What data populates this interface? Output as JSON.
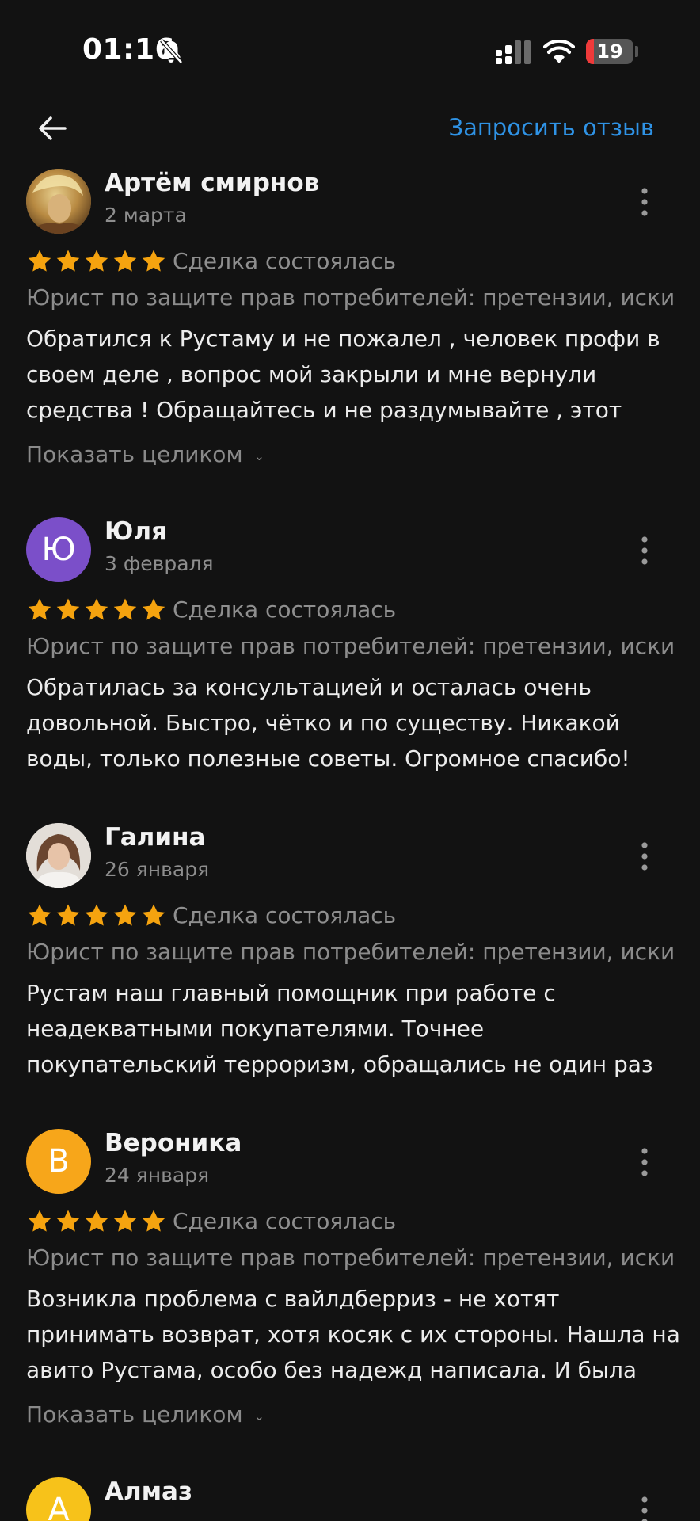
{
  "status_bar": {
    "time": "01:16",
    "battery": "19"
  },
  "header": {
    "request_review": "Запросить отзыв"
  },
  "reviews": [
    {
      "name": "Артём смирнов",
      "date": "2 марта",
      "rating": 5,
      "deal_status": "Сделка состоялась",
      "service": "Юрист по защите прав потребителей: претензии, иски",
      "text_lines": [
        "Обратился к Рустаму и не пожалел , человек профи в",
        "своем деле , вопрос мой закрыли и мне вернули",
        "средства ! Обращайтесь и не раздумывайте , этот"
      ],
      "show_more": "Показать целиком"
    },
    {
      "name": "Юля",
      "avatar_letter": "Ю",
      "avatar_color": "#7b4fc9",
      "date": "3 февраля",
      "rating": 5,
      "deal_status": "Сделка состоялась",
      "service": "Юрист по защите прав потребителей: претензии, иски",
      "text_lines": [
        "Обратилась за консультацией и осталась очень",
        "довольной. Быстро, чётко и по существу. Никакой",
        "воды, только полезные советы. Огромное спасибо!"
      ]
    },
    {
      "name": "Галина",
      "date": "26 января",
      "rating": 5,
      "deal_status": "Сделка состоялась",
      "service": "Юрист по защите прав потребителей: претензии, иски",
      "text_lines": [
        "Рустам наш главный помощник при работе с",
        "неадекватными покупателями. Точнее",
        "покупательский терроризм, обращались не один раз"
      ]
    },
    {
      "name": "Вероника",
      "avatar_letter": "В",
      "avatar_color": "#f7a61a",
      "date": "24 января",
      "rating": 5,
      "deal_status": "Сделка состоялась",
      "service": "Юрист по защите прав потребителей: претензии, иски",
      "text_lines": [
        "Возникла проблема с вайлдберриз - не хотят",
        "принимать возврат, хотя косяк с их стороны. Нашла на",
        "авито Рустама, особо без надежд написала. И была"
      ],
      "show_more": "Показать целиком"
    },
    {
      "name": "Алмаз",
      "avatar_letter": "А",
      "avatar_color": "#f7c21a"
    }
  ],
  "colors": {
    "background": "#121212",
    "accent_link": "#2f93e6",
    "star": "#f5a30f",
    "muted_text": "#8e8e8e"
  }
}
